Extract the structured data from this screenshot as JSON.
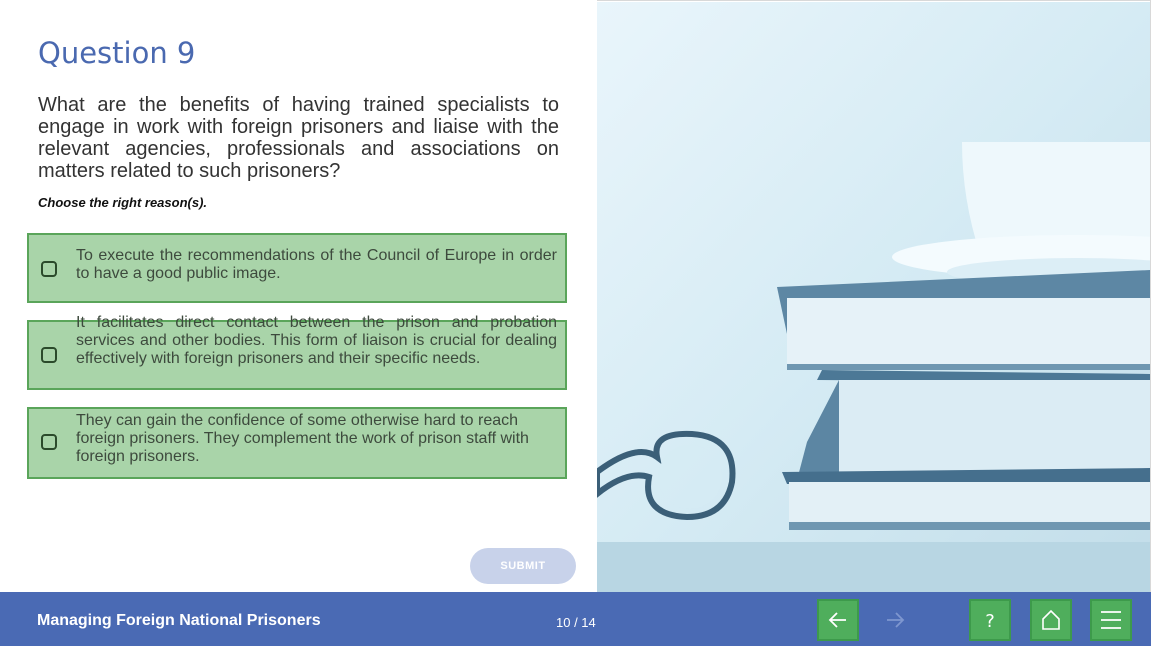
{
  "question": {
    "title": "Question 9",
    "text": "What are the benefits of having trained specialists to engage in work with foreign prisoners and liaise with the relevant agencies, professionals and associations on matters related to such prisoners?",
    "instruction": "Choose the right reason(s)."
  },
  "options": [
    {
      "text": "To execute the recommendations of the Council of Europe in order to have a good public image.",
      "checked": false
    },
    {
      "text": "It facilitates direct contact between the prison and probation services and other bodies. This form of liaison is crucial for dealing effectively with foreign prisoners and their specific needs.",
      "checked": false
    },
    {
      "text": "They can gain the confidence of some otherwise hard to reach foreign prisoners. They complement the work of prison staff with foreign prisoners.",
      "checked": false
    }
  ],
  "submit_label": "SUBMIT",
  "footer": {
    "course_title": "Managing Foreign National Prisoners",
    "page_counter": "10 / 14"
  },
  "colors": {
    "brand_blue": "#4a6ab4",
    "title_blue": "#4a69b0",
    "option_green": "#74ba74",
    "nav_green": "#4fae5c"
  },
  "icons": {
    "prev": "arrow-left-icon",
    "next": "arrow-right-icon",
    "help": "question-mark-icon",
    "home": "home-icon",
    "menu": "hamburger-menu-icon"
  }
}
